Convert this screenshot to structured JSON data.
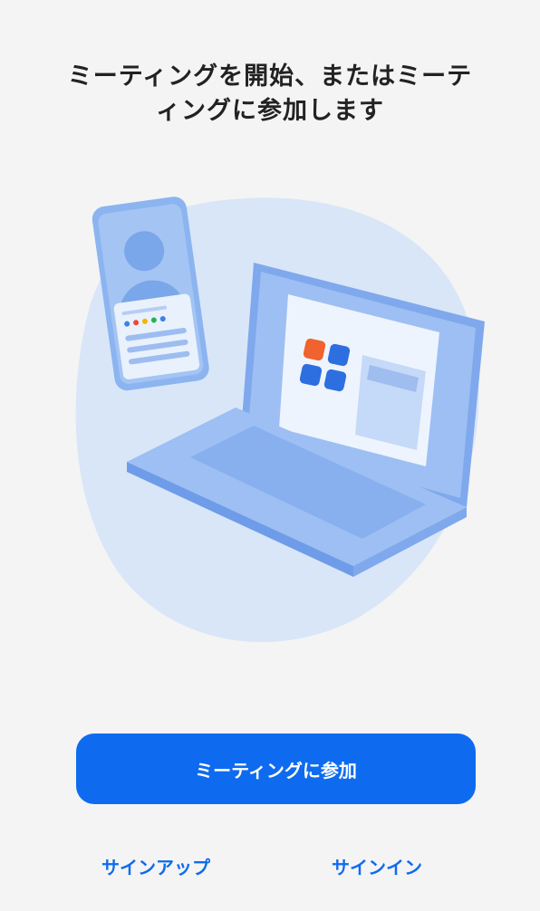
{
  "headline": {
    "line1": "ミーティングを開始、またはミーテ",
    "line2": "ィングに参加します"
  },
  "primary_button": {
    "label": "ミーティングに参加"
  },
  "links": {
    "signup": "サインアップ",
    "signin": "サインイン"
  },
  "colors": {
    "accent": "#0e6bf0",
    "background": "#f4f4f4",
    "blob": "#d9e6f8",
    "illustration_blue": "#8bb4f0",
    "illustration_dark": "#6d9de6"
  },
  "illustration": {
    "icon_name": "meeting-devices-illustration"
  }
}
